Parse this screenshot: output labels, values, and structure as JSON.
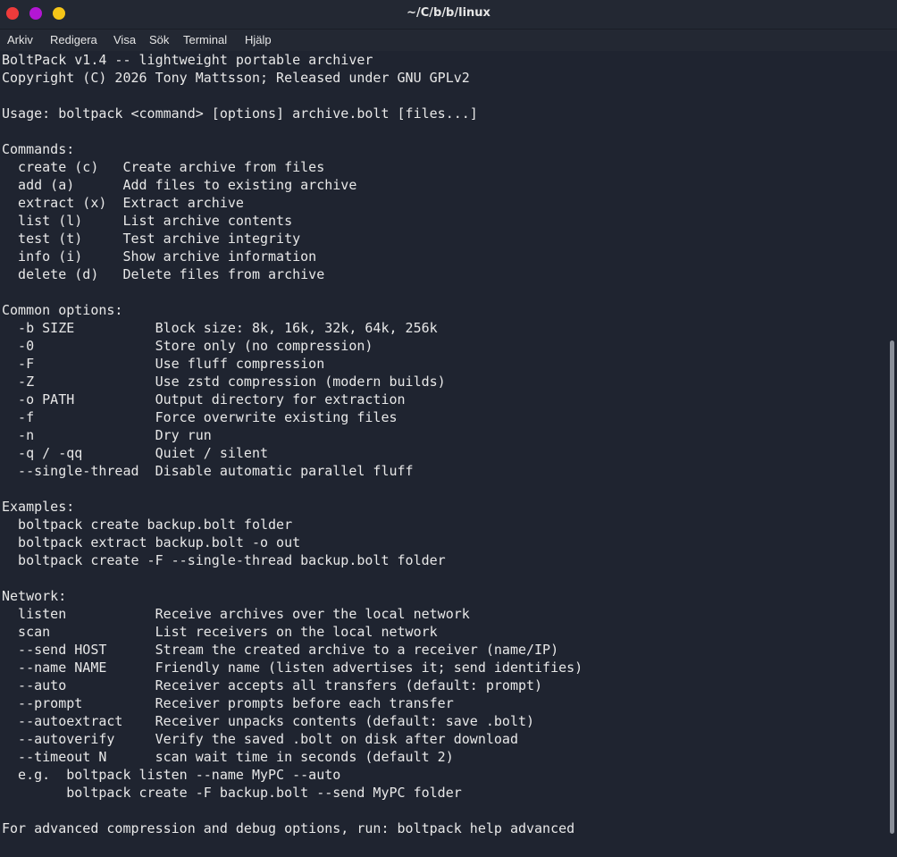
{
  "window": {
    "title": "~/C/b/b/linux",
    "controls": {
      "close_color": "#ee3b3b",
      "minimize_color": "#b316d4",
      "maximize_color": "#f5c518"
    }
  },
  "menu": [
    "Arkiv",
    "Redigera",
    "Visa",
    "Sök",
    "Terminal",
    "Hjälp"
  ],
  "terminal": {
    "lines": [
      "BoltPack v1.4 -- lightweight portable archiver",
      "Copyright (C) 2026 Tony Mattsson; Released under GNU GPLv2",
      "",
      "Usage: boltpack <command> [options] archive.bolt [files...]",
      "",
      "Commands:",
      "  create (c)   Create archive from files",
      "  add (a)      Add files to existing archive",
      "  extract (x)  Extract archive",
      "  list (l)     List archive contents",
      "  test (t)     Test archive integrity",
      "  info (i)     Show archive information",
      "  delete (d)   Delete files from archive",
      "",
      "Common options:",
      "  -b SIZE          Block size: 8k, 16k, 32k, 64k, 256k",
      "  -0               Store only (no compression)",
      "  -F               Use fluff compression",
      "  -Z               Use zstd compression (modern builds)",
      "  -o PATH          Output directory for extraction",
      "  -f               Force overwrite existing files",
      "  -n               Dry run",
      "  -q / -qq         Quiet / silent",
      "  --single-thread  Disable automatic parallel fluff",
      "",
      "Examples:",
      "  boltpack create backup.bolt folder",
      "  boltpack extract backup.bolt -o out",
      "  boltpack create -F --single-thread backup.bolt folder",
      "",
      "Network:",
      "  listen           Receive archives over the local network",
      "  scan             List receivers on the local network",
      "  --send HOST      Stream the created archive to a receiver (name/IP)",
      "  --name NAME      Friendly name (listen advertises it; send identifies)",
      "  --auto           Receiver accepts all transfers (default: prompt)",
      "  --prompt         Receiver prompts before each transfer",
      "  --autoextract    Receiver unpacks contents (default: save .bolt)",
      "  --autoverify     Verify the saved .bolt on disk after download",
      "  --timeout N      scan wait time in seconds (default 2)",
      "  e.g.  boltpack listen --name MyPC --auto",
      "        boltpack create -F backup.bolt --send MyPC folder",
      "",
      "For advanced compression and debug options, run: boltpack help advanced"
    ]
  }
}
